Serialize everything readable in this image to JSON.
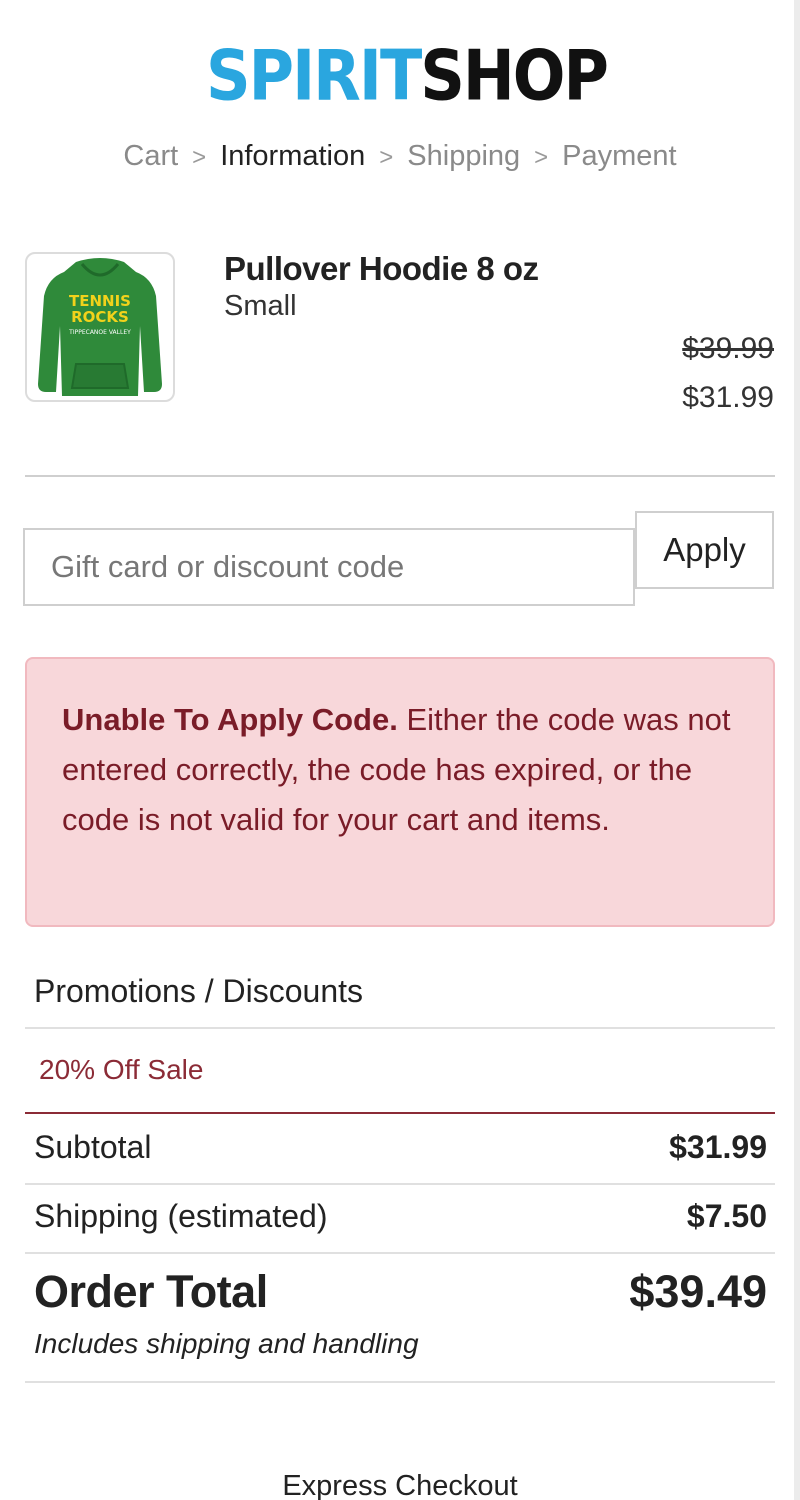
{
  "brand": {
    "logo_text_part1": "SPIRIT",
    "logo_text_part2": "SHOP",
    "colors": {
      "blue": "#2aa6df",
      "black": "#111111"
    }
  },
  "breadcrumb": {
    "items": [
      {
        "label": "Cart",
        "state": "link"
      },
      {
        "label": "Information",
        "state": "current"
      },
      {
        "label": "Shipping",
        "state": "upcoming"
      },
      {
        "label": "Payment",
        "state": "upcoming"
      }
    ],
    "separator": ">"
  },
  "product": {
    "title": "Pullover Hoodie 8 oz",
    "variant": "Small",
    "original_price": "$39.99",
    "sale_price": "$31.99",
    "image": {
      "icon": "green-hoodie-image",
      "print_line1": "TENNIS",
      "print_line2": "ROCKS",
      "print_line3": "TIPPECANOE VALLEY",
      "hoodie_color": "#2f8a3a",
      "print_color": "#f2d21b"
    }
  },
  "discount": {
    "placeholder": "Gift card or discount code",
    "value": "",
    "apply_label": "Apply"
  },
  "error": {
    "title": "Unable To Apply Code.",
    "message": "Either the code was not entered correctly, the code has expired, or the code is not valid for your cart and items.",
    "colors": {
      "background": "#f8d7da",
      "text": "#7a1c28"
    }
  },
  "promotions": {
    "heading": "Promotions / Discounts",
    "items": [
      "20% Off Sale"
    ],
    "accent": "#8b2b36"
  },
  "summary": {
    "subtotal_label": "Subtotal",
    "subtotal_value": "$31.99",
    "shipping_label": "Shipping (estimated)",
    "shipping_value": "$7.50",
    "total_label": "Order Total",
    "total_value": "$39.49",
    "total_note": "Includes shipping and handling"
  },
  "express": {
    "label": "Express Checkout"
  }
}
